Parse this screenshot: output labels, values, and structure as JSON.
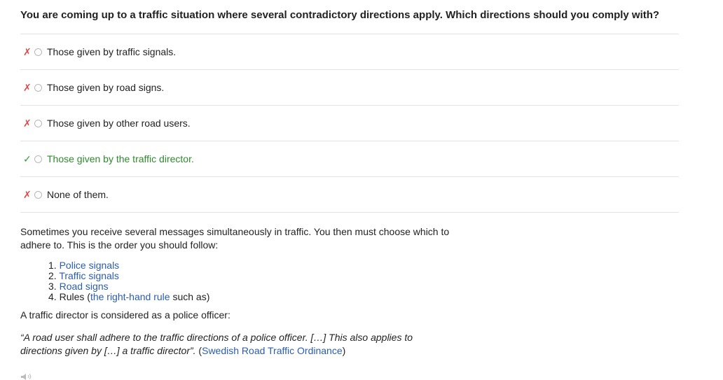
{
  "question": "You are coming up to a traffic situation where several contradictory directions apply. Which directions should you comply with?",
  "answers": [
    {
      "mark": "✗",
      "text": "Those given by traffic signals.",
      "correct": false
    },
    {
      "mark": "✗",
      "text": "Those given by road signs.",
      "correct": false
    },
    {
      "mark": "✗",
      "text": "Those given by other road users.",
      "correct": false
    },
    {
      "mark": "✓",
      "text": "Those given by the traffic director.",
      "correct": true
    },
    {
      "mark": "✗",
      "text": "None of them.",
      "correct": false
    }
  ],
  "explanation": {
    "intro": "Sometimes you receive several messages simultaneously in traffic. You then must choose which to adhere to. This is the order you should follow:",
    "order": [
      {
        "num": "1.",
        "link": "Police signals",
        "suffix": ""
      },
      {
        "num": "2.",
        "link": "Traffic signals",
        "suffix": ""
      },
      {
        "num": "3.",
        "link": "Road signs",
        "suffix": ""
      },
      {
        "num": "4.",
        "prefix": "Rules (",
        "link": "the right-hand rule",
        "suffix": " such as)"
      }
    ],
    "para2": "A traffic director is considered as a police officer:",
    "quote": "“A road user shall adhere to the traffic directions of a police officer. […] This also applies to directions given by […] a traffic director”.",
    "quote_source_open": " (",
    "quote_source": "Swedish Road Traffic Ordinance",
    "quote_source_close": ")"
  },
  "colors": {
    "wrong": "#e04848",
    "right": "#3a9a3a",
    "link": "#2a5db0"
  },
  "icons": {
    "speaker": "speaker-icon"
  }
}
